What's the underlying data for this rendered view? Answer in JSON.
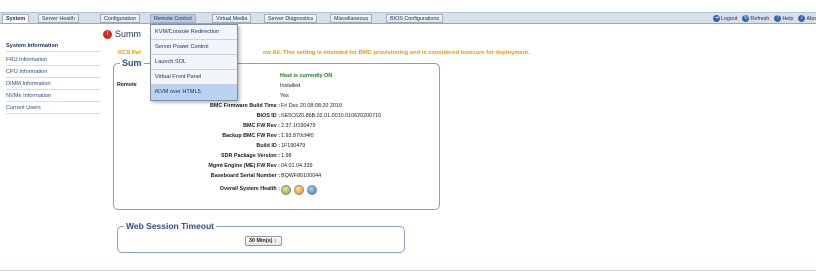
{
  "nav": {
    "tabs": [
      "System",
      "Server Health",
      "Configuration",
      "Remote Control",
      "Virtual Media",
      "Server Diagnostics",
      "Miscellaneous",
      "BIOS Configurations"
    ],
    "links": [
      "Logout",
      "Refresh",
      "Help",
      "Abo"
    ]
  },
  "menu": {
    "items": [
      "KVM/Console Redirection",
      "Server Power Control",
      "Launch SOL",
      "Virtual Front Panel",
      "iKVM over HTML5"
    ]
  },
  "sidebar": {
    "items": [
      "System Information",
      "FRU Information",
      "CPU Information",
      "DIMM Information",
      "NVMe Information",
      "Current Users"
    ]
  },
  "main": {
    "title": "Summ",
    "warning_prefix": "KCS Pol",
    "warning_suffix": "ow All. This setting is intended for BMC provisioning and is considered insecure for deployment.",
    "summary_legend": "Sum",
    "remote_label_fragment": "Remote",
    "rows": [
      {
        "label": "",
        "value": "Host is currently ON"
      },
      {
        "label": "",
        "value": "Installed"
      },
      {
        "label": "",
        "value": "Yes"
      },
      {
        "label": "BMC Firmware Build Time :",
        "value": "Fri Dec 20 08:08:20 2019"
      },
      {
        "label": "BIOS ID :",
        "value": "SE5C620.86B.02.01.0010.010620200716"
      },
      {
        "label": "BMC FW Rev :",
        "value": "2.37.1f190479"
      },
      {
        "label": "Backup BMC FW Rev :",
        "value": "1.93.870cf4f0"
      },
      {
        "label": "Build ID :",
        "value": "1F190479"
      },
      {
        "label": "SDR Package Version :",
        "value": "1.98"
      },
      {
        "label": "Mgmt Engine (ME) FW Rev :",
        "value": "04.01.04.339"
      },
      {
        "label": "Baseboard Serial Number :",
        "value": "BQWF80100044"
      }
    ],
    "health_label": "Overall System Health :",
    "health_colors": [
      "#6fb33a",
      "#e08a10",
      "#2e78c2"
    ],
    "web_session_legend": "Web Session Timeout",
    "web_session_value": "30 Min(s) ↕"
  }
}
